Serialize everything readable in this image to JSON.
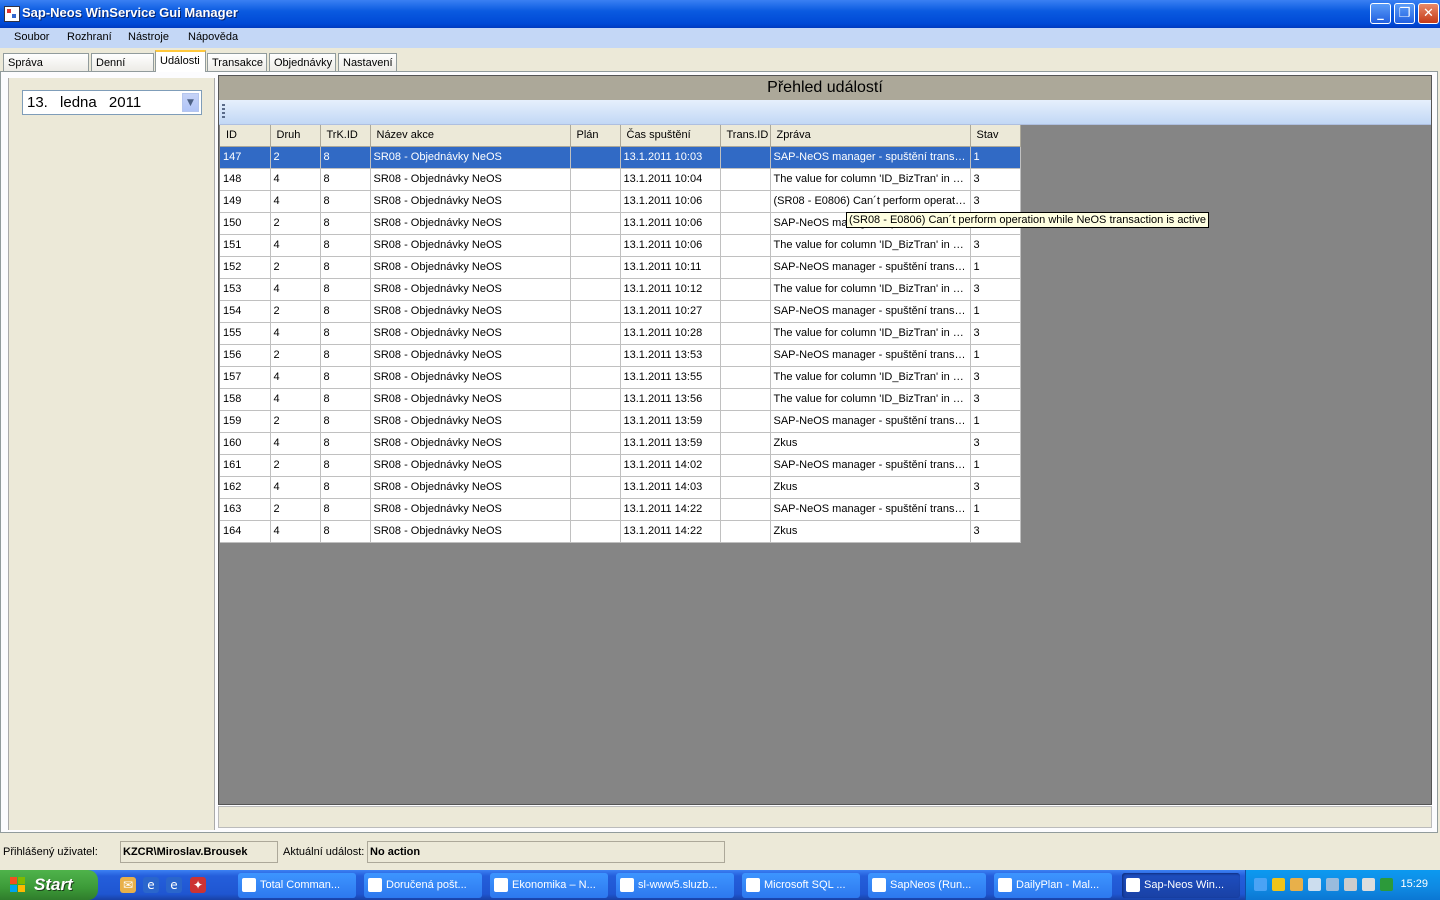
{
  "window": {
    "title": "Sap-Neos WinService Gui Manager"
  },
  "menu": [
    "Soubor",
    "Rozhraní",
    "Nástroje",
    "Nápověda"
  ],
  "tabs": [
    "Správa rozhraní",
    "Denní plán",
    "Události",
    "Transakce",
    "Objednávky",
    "Nastavení"
  ],
  "active_tab": "Události",
  "date_picker": {
    "day": "13.",
    "month": "ledna",
    "year": "2011"
  },
  "panel": {
    "title": "Přehled událostí"
  },
  "grid": {
    "columns": [
      "ID",
      "Druh",
      "TrK.ID",
      "Název akce",
      "Plán",
      "Čas spuštění",
      "Trans.ID",
      "Zpráva",
      "Stav"
    ],
    "selected_row": 0,
    "rows": [
      [
        "147",
        "2",
        "8",
        "SR08 - Objednávky NeOS",
        "",
        "13.1.2011 10:03",
        "",
        "SAP-NeOS manager - spuštění transa...",
        "1"
      ],
      [
        "148",
        "4",
        "8",
        "SR08 - Objednávky NeOS",
        "",
        "13.1.2011 10:04",
        "",
        "The value for column 'ID_BizTran' in ta...",
        "3"
      ],
      [
        "149",
        "4",
        "8",
        "SR08 - Objednávky NeOS",
        "",
        "13.1.2011 10:06",
        "",
        "(SR08 - E0806) Can´t perform operatio...",
        "3"
      ],
      [
        "150",
        "2",
        "8",
        "SR08 - Objednávky NeOS",
        "",
        "13.1.2011 10:06",
        "",
        "SAP-NeOS manager - spuštění transa...",
        "1"
      ],
      [
        "151",
        "4",
        "8",
        "SR08 - Objednávky NeOS",
        "",
        "13.1.2011 10:06",
        "",
        "The value for column 'ID_BizTran' in ta...",
        "3"
      ],
      [
        "152",
        "2",
        "8",
        "SR08 - Objednávky NeOS",
        "",
        "13.1.2011 10:11",
        "",
        "SAP-NeOS manager - spuštění transa...",
        "1"
      ],
      [
        "153",
        "4",
        "8",
        "SR08 - Objednávky NeOS",
        "",
        "13.1.2011 10:12",
        "",
        "The value for column 'ID_BizTran' in ta...",
        "3"
      ],
      [
        "154",
        "2",
        "8",
        "SR08 - Objednávky NeOS",
        "",
        "13.1.2011 10:27",
        "",
        "SAP-NeOS manager - spuštění transa...",
        "1"
      ],
      [
        "155",
        "4",
        "8",
        "SR08 - Objednávky NeOS",
        "",
        "13.1.2011 10:28",
        "",
        "The value for column 'ID_BizTran' in ta...",
        "3"
      ],
      [
        "156",
        "2",
        "8",
        "SR08 - Objednávky NeOS",
        "",
        "13.1.2011 13:53",
        "",
        "SAP-NeOS manager - spuštění transa...",
        "1"
      ],
      [
        "157",
        "4",
        "8",
        "SR08 - Objednávky NeOS",
        "",
        "13.1.2011 13:55",
        "",
        "The value for column 'ID_BizTran' in ta...",
        "3"
      ],
      [
        "158",
        "4",
        "8",
        "SR08 - Objednávky NeOS",
        "",
        "13.1.2011 13:56",
        "",
        "The value for column 'ID_BizTran' in ta...",
        "3"
      ],
      [
        "159",
        "2",
        "8",
        "SR08 - Objednávky NeOS",
        "",
        "13.1.2011 13:59",
        "",
        "SAP-NeOS manager - spuštění transa...",
        "1"
      ],
      [
        "160",
        "4",
        "8",
        "SR08 - Objednávky NeOS",
        "",
        "13.1.2011 13:59",
        "",
        "Zkus",
        "3"
      ],
      [
        "161",
        "2",
        "8",
        "SR08 - Objednávky NeOS",
        "",
        "13.1.2011 14:02",
        "",
        "SAP-NeOS manager - spuštění transa...",
        "1"
      ],
      [
        "162",
        "4",
        "8",
        "SR08 - Objednávky NeOS",
        "",
        "13.1.2011 14:03",
        "",
        "Zkus",
        "3"
      ],
      [
        "163",
        "2",
        "8",
        "SR08 - Objednávky NeOS",
        "",
        "13.1.2011 14:22",
        "",
        "SAP-NeOS manager - spuštění transa...",
        "1"
      ],
      [
        "164",
        "4",
        "8",
        "SR08 - Objednávky NeOS",
        "",
        "13.1.2011 14:22",
        "",
        "Zkus",
        "3"
      ]
    ]
  },
  "tooltip": "(SR08 - E0806) Can´t perform operation while NeOS transaction is active",
  "status": {
    "user_label": "Přihlášený uživatel:",
    "user_value": "KZCR\\Miroslav.Brousek",
    "event_label": "Aktuální událost:",
    "event_value": "No action"
  },
  "taskbar": {
    "start_label": "Start",
    "tasks": [
      {
        "label": "Total Comman...",
        "icon": "total-commander-icon"
      },
      {
        "label": "Doručená pošt...",
        "icon": "outlook-icon"
      },
      {
        "label": "Ekonomika – N...",
        "icon": "ie-icon"
      },
      {
        "label": "sl-www5.sluzb...",
        "icon": "remote-desktop-icon"
      },
      {
        "label": "Microsoft SQL ...",
        "icon": "sql-server-icon"
      },
      {
        "label": "SapNeos (Run...",
        "icon": "visual-studio-icon"
      },
      {
        "label": "DailyPlan - Mal...",
        "icon": "paint-icon"
      },
      {
        "label": "Sap-Neos Win...",
        "icon": "app-icon"
      }
    ],
    "active_task": 7,
    "clock": "15:29"
  },
  "colors": {
    "selection": "#316ac5",
    "taskbar": "#245edb",
    "start": "#3c9a38"
  }
}
